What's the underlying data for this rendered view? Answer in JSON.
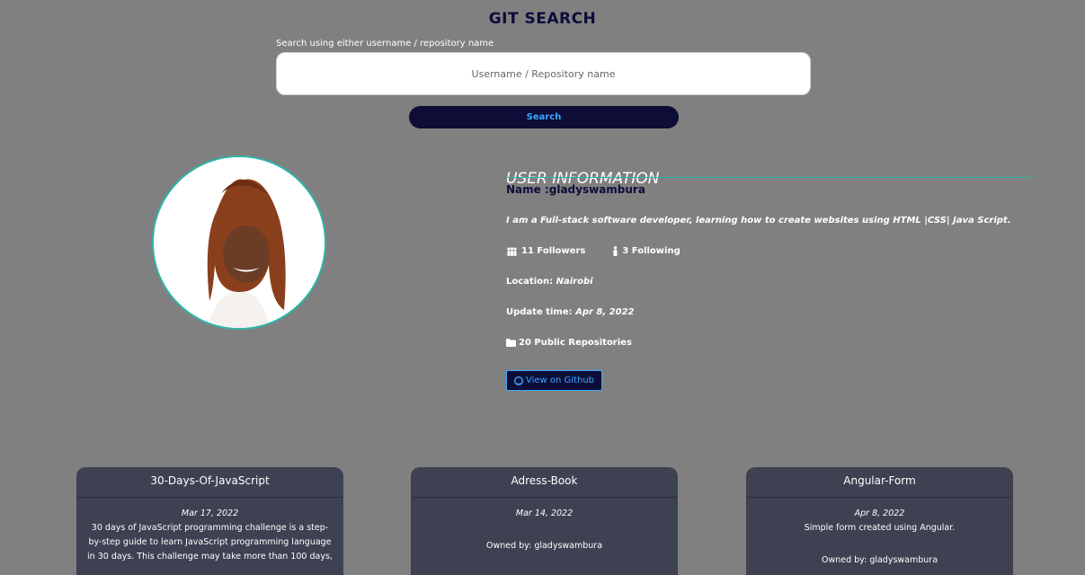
{
  "header": {
    "title": "GIT SEARCH"
  },
  "search": {
    "label": "Search using either username / repository name",
    "placeholder": "Username / Repository name",
    "value": "",
    "button_label": "Search"
  },
  "profile": {
    "section_heading": "USER INFORMATION",
    "name": "Name :gladyswambura",
    "bio": "I am a Full-stack software developer, learning how to create websites using HTML |CSS| Java Script.",
    "followers": "11 Followers",
    "following": "3 Following",
    "location_label": "Location:",
    "location_value": "Nairobi",
    "update_label": "Update time:",
    "update_value": "Apr 8, 2022",
    "repos": "20 Public Repositories",
    "github_button": "View on Github"
  },
  "repositories": [
    {
      "name": "30-Days-Of-JavaScript",
      "date": "Mar 17, 2022",
      "description": "30 days of JavaScript programming challenge is a step-by-step guide to learn JavaScript programming language in 30 days. This challenge may take more than 100 days,",
      "owner": ""
    },
    {
      "name": "Adress-Book",
      "date": "Mar 14, 2022",
      "description": "",
      "owner": "Owned by: gladyswambura"
    },
    {
      "name": "Angular-Form",
      "date": "Apr 8, 2022",
      "description": "Simple form created using Angular.",
      "owner": "Owned by: gladyswambura"
    }
  ],
  "colors": {
    "background": "#808080",
    "navy": "#0d0d38",
    "accent": "#3aa8ff",
    "teal": "#2bb7a6",
    "card": "#3d4152"
  }
}
